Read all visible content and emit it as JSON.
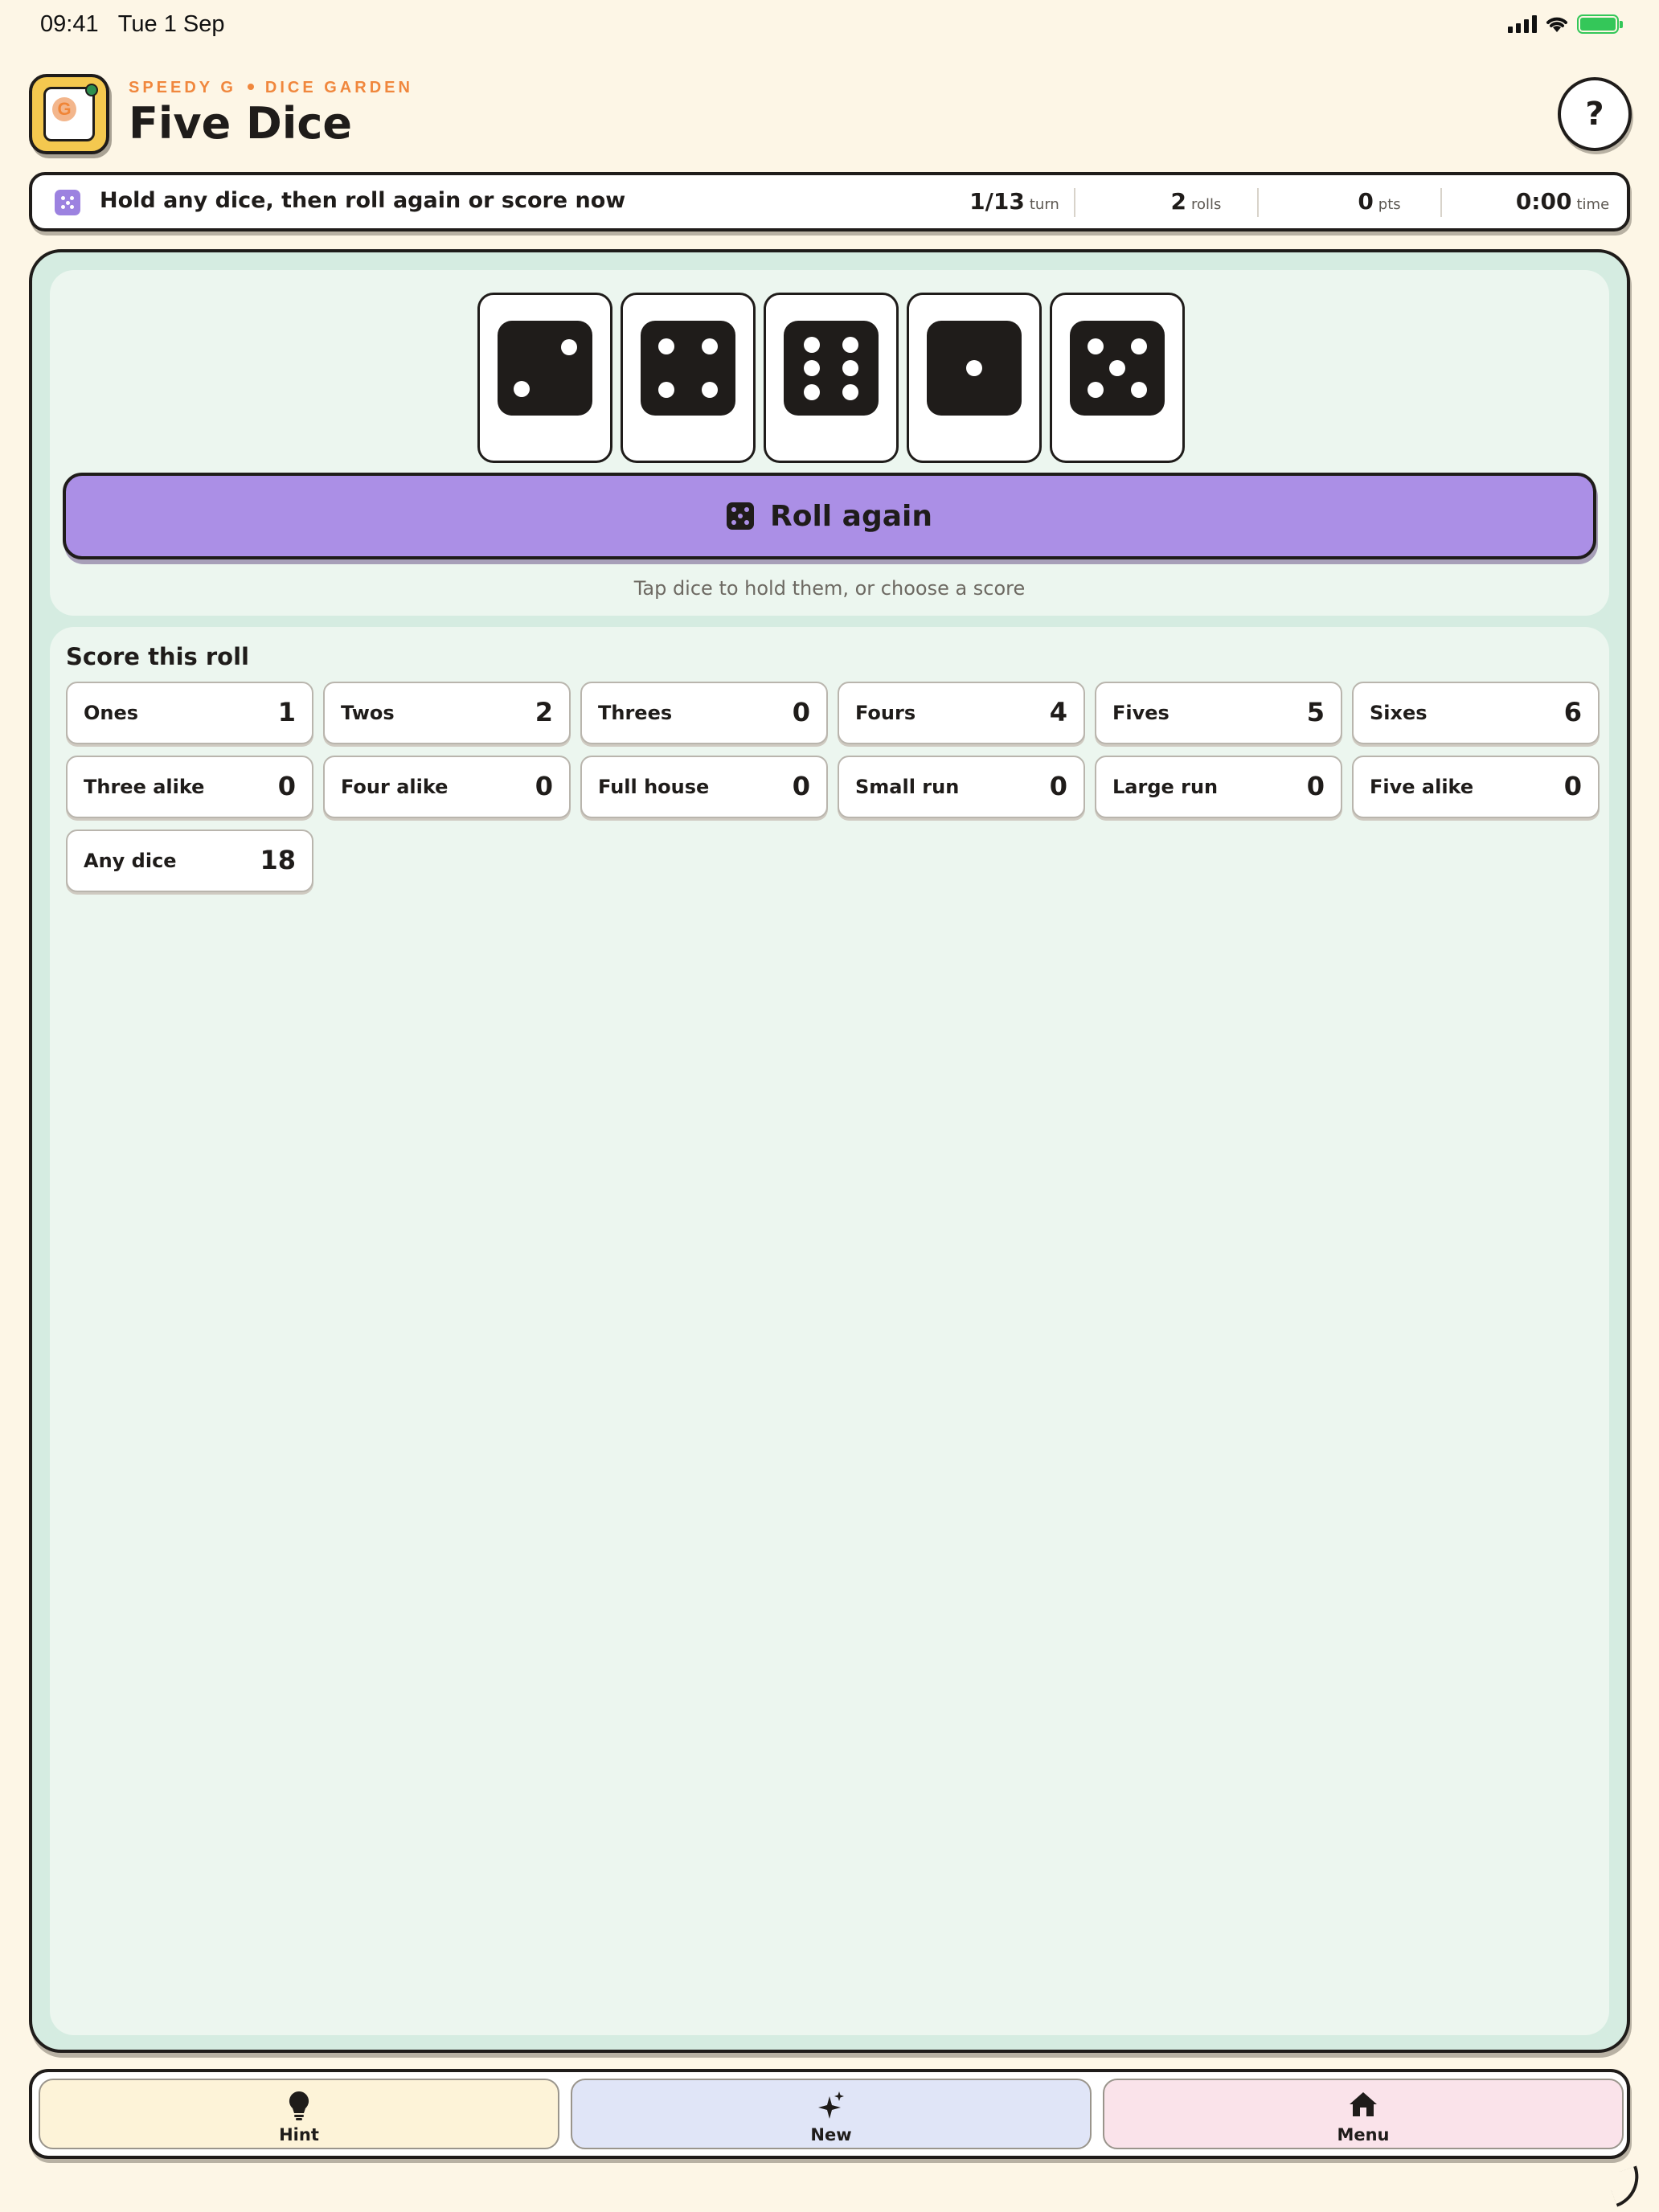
{
  "status_bar": {
    "time": "09:41",
    "date": "Tue 1 Sep",
    "icons": [
      "signal-icon",
      "wifi-icon",
      "battery-charging-icon"
    ]
  },
  "header": {
    "brand": "SPEEDY G",
    "collection": "DICE GARDEN",
    "title": "Five Dice",
    "app_icon_letter": "G",
    "help_label": "?"
  },
  "status": {
    "message": "Hold any dice, then roll again or score now",
    "turn": {
      "value": "1/13",
      "label": "turn"
    },
    "rolls": {
      "value": "2",
      "label": "rolls"
    },
    "points": {
      "value": "0",
      "label": "pts"
    },
    "time": {
      "value": "0:00",
      "label": "time"
    }
  },
  "dice": [
    2,
    4,
    6,
    1,
    5
  ],
  "roll_button": {
    "label": "Roll again"
  },
  "dice_hint": "Tap dice to hold them, or choose a score",
  "scores": {
    "title": "Score this roll",
    "cells": [
      {
        "label": "Ones",
        "value": "1"
      },
      {
        "label": "Twos",
        "value": "2"
      },
      {
        "label": "Threes",
        "value": "0"
      },
      {
        "label": "Fours",
        "value": "4"
      },
      {
        "label": "Fives",
        "value": "5"
      },
      {
        "label": "Sixes",
        "value": "6"
      },
      {
        "label": "Three alike",
        "value": "0"
      },
      {
        "label": "Four alike",
        "value": "0"
      },
      {
        "label": "Full house",
        "value": "0"
      },
      {
        "label": "Small run",
        "value": "0"
      },
      {
        "label": "Large run",
        "value": "0"
      },
      {
        "label": "Five alike",
        "value": "0"
      },
      {
        "label": "Any dice",
        "value": "18"
      }
    ]
  },
  "tabs": [
    {
      "label": "Hint",
      "icon": "lightbulb-icon",
      "color": "#fdf3d8"
    },
    {
      "label": "New",
      "icon": "sparkle-icon",
      "color": "#e0e5f7"
    },
    {
      "label": "Menu",
      "icon": "home-icon",
      "color": "#fae3ea"
    }
  ],
  "colors": {
    "accent": "#ab8fe6",
    "brand": "#f0873d",
    "board": "#d5ece1",
    "background": "#fdf6e6"
  }
}
